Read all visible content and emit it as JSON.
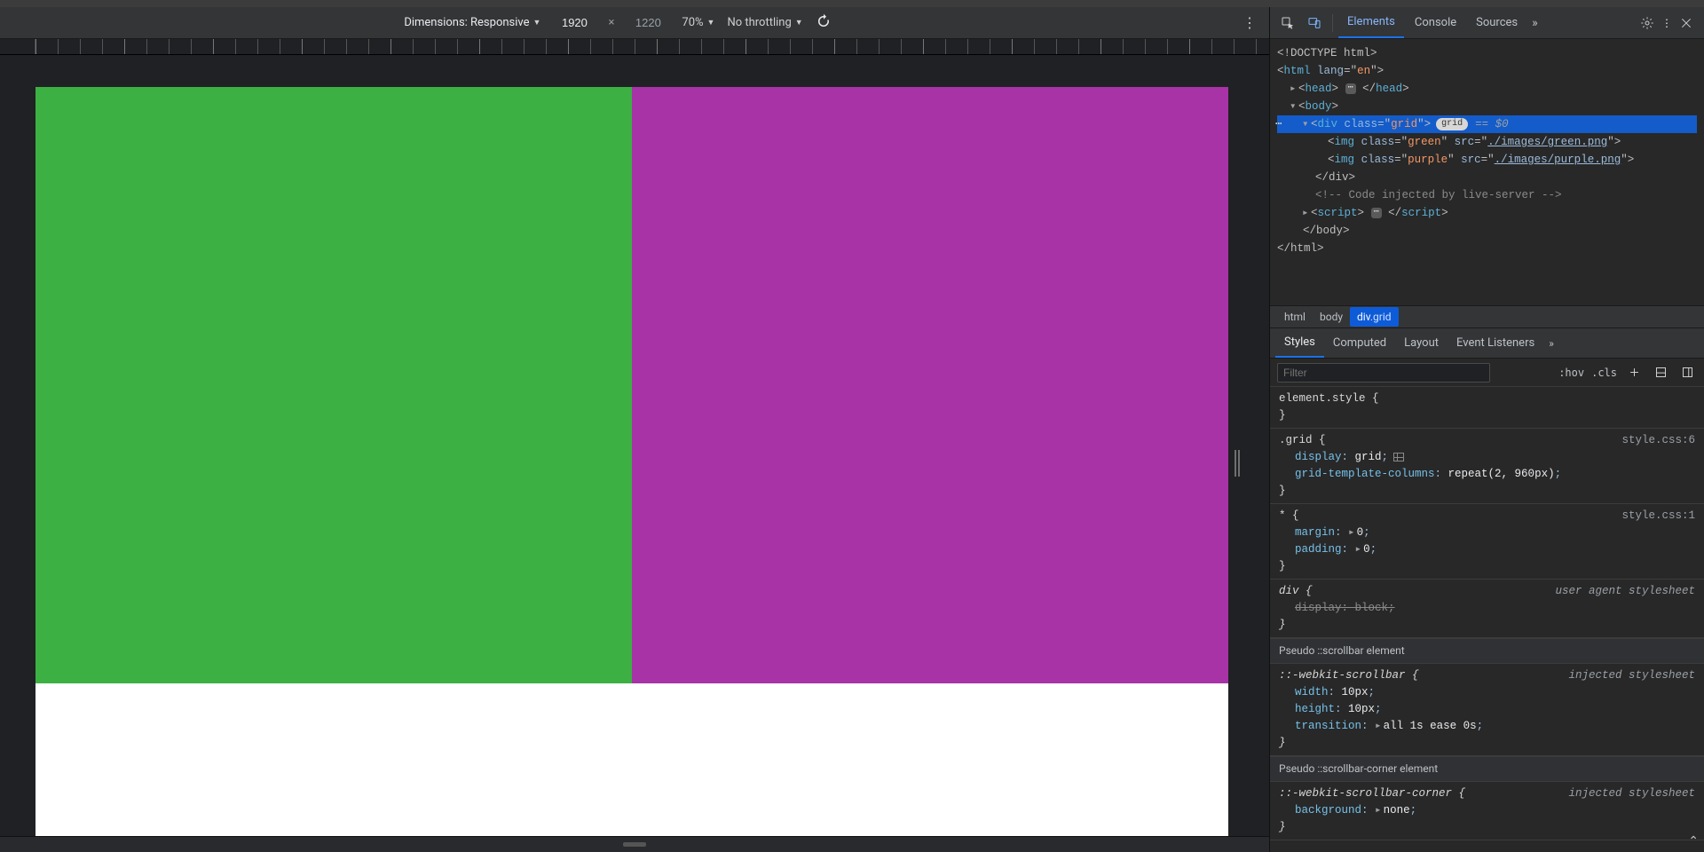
{
  "device_toolbar": {
    "dimensions_label": "Dimensions: Responsive",
    "width": "1920",
    "height": "1220",
    "separator": "×",
    "zoom": "70%",
    "throttle": "No throttling"
  },
  "tabs": {
    "elements": "Elements",
    "console": "Console",
    "sources": "Sources"
  },
  "dom": {
    "doctype": "<!DOCTYPE html>",
    "html_open": "<html lang=\"en\">",
    "head_open": "<head>",
    "head_close": "</head>",
    "body_open": "<body>",
    "grid_open_tag": "div",
    "grid_open_attr": "class",
    "grid_open_val": "grid",
    "grid_badge": "grid",
    "grid_eq": "== $0",
    "img1_tag": "img",
    "img1_class": "green",
    "img1_src": "./images/green.png",
    "img2_tag": "img",
    "img2_class": "purple",
    "img2_src": "./images/purple.png",
    "div_close": "</div>",
    "comment": "<!-- Code injected by live-server -->",
    "script_open": "<script>",
    "script_close": "</script>",
    "body_close": "</body>",
    "html_close": "</html>"
  },
  "crumb": {
    "c1": "html",
    "c2": "body",
    "c3_tag": "div",
    "c3_cls": ".grid"
  },
  "subtabs": {
    "styles": "Styles",
    "computed": "Computed",
    "layout": "Layout",
    "listeners": "Event Listeners"
  },
  "styles_toolbar": {
    "filter_placeholder": "Filter",
    "hov": ":hov",
    "cls": ".cls"
  },
  "rules": {
    "element_style": "element.style {",
    "close_brace": "}",
    "grid_source": "style.css:6",
    "grid_selector": ".grid {",
    "grid_display_name": "display",
    "grid_display_val": "grid",
    "grid_gtc_name": "grid-template-columns",
    "grid_gtc_val": "repeat(2, 960px)",
    "star_source": "style.css:1",
    "star_selector": "* {",
    "star_margin_name": "margin",
    "star_margin_val": "0",
    "star_padding_name": "padding",
    "star_padding_val": "0",
    "ua_source": "user agent stylesheet",
    "ua_selector": "div {",
    "ua_display_name": "display",
    "ua_display_val": "block",
    "pseudo_scrollbar": "Pseudo ::scrollbar element",
    "scrollbar_source": "injected stylesheet",
    "scrollbar_selector": "::-webkit-scrollbar {",
    "scrollbar_width_name": "width",
    "scrollbar_width_val": "10px",
    "scrollbar_height_name": "height",
    "scrollbar_height_val": "10px",
    "scrollbar_transition_name": "transition",
    "scrollbar_transition_val": "all 1s ease 0s",
    "pseudo_corner": "Pseudo ::scrollbar-corner element",
    "corner_selector": "::-webkit-scrollbar-corner {",
    "corner_bg_name": "background",
    "corner_bg_val": "none"
  }
}
